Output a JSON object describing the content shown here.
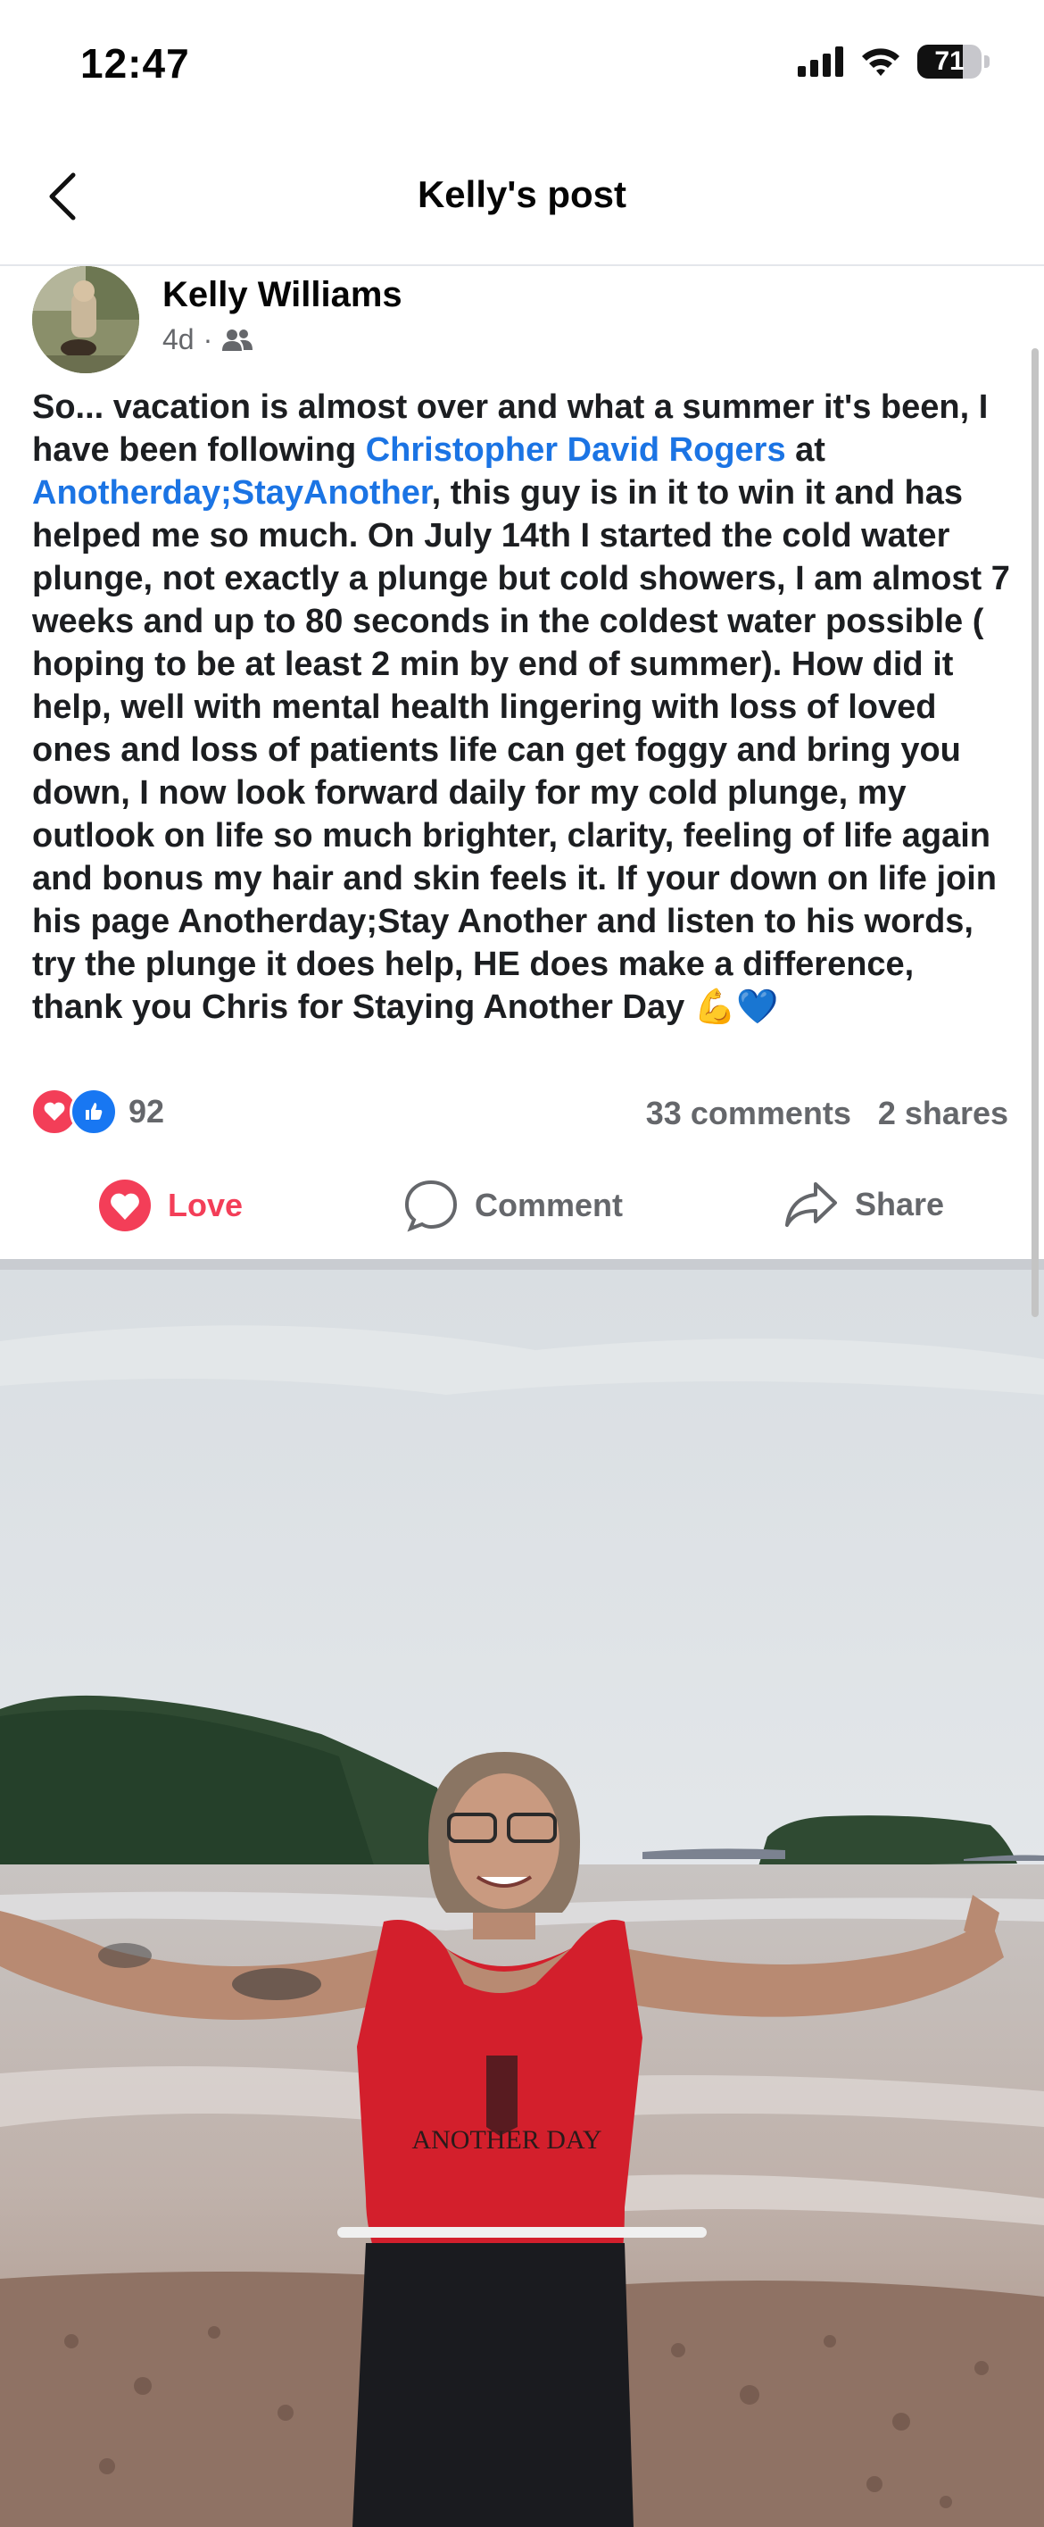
{
  "status_bar": {
    "time": "12:47",
    "battery_level": "71",
    "battery_fraction": 0.71,
    "icons": [
      "signal-icon",
      "wifi-icon",
      "battery-icon"
    ]
  },
  "nav": {
    "back_icon": "chevron-left-icon",
    "title": "Kelly's post"
  },
  "post": {
    "author": "Kelly Williams",
    "time_ago": "4d",
    "separator": "·",
    "audience_icon": "friends-icon",
    "text": {
      "part1": "So... vacation is almost over and what a summer it's been, I have been following  ",
      "mention1": "Christopher David Rogers",
      "part2": " at ",
      "mention2": "Anotherday;StayAnother",
      "part3": ", this guy is in it to win it and has helped me so much. On July 14th I started the cold water plunge, not exactly a plunge but cold showers, I am almost 7 weeks and up to 80 seconds in the coldest water possible ( hoping to be at least 2 min by end of summer). How did it help, well with mental health lingering with loss of loved ones and loss of patients life can get foggy and bring you down, I  now look forward daily for my cold plunge, my outlook on life so much brighter, clarity, feeling of life again and bonus my hair and skin feels it. If your down on life join his page Anotherday;Stay Another and listen to his words, try the plunge it does help, HE does make a difference, thank you Chris for Staying Another Day ",
      "emojis": "💪💙"
    },
    "reactions": {
      "icons": [
        "love-reaction-icon",
        "like-reaction-icon"
      ],
      "count": "92"
    },
    "comments": "33 comments",
    "shares": "2 shares",
    "actions": {
      "love": "Love",
      "comment": "Comment",
      "share": "Share"
    },
    "photo": {
      "shirt_text": "ANOTHER DAY"
    }
  },
  "colors": {
    "link": "#1b74e4",
    "love": "#f33e58",
    "like": "#1877f2",
    "secondary_text": "#65676b",
    "divider": "#c9ccd1"
  }
}
